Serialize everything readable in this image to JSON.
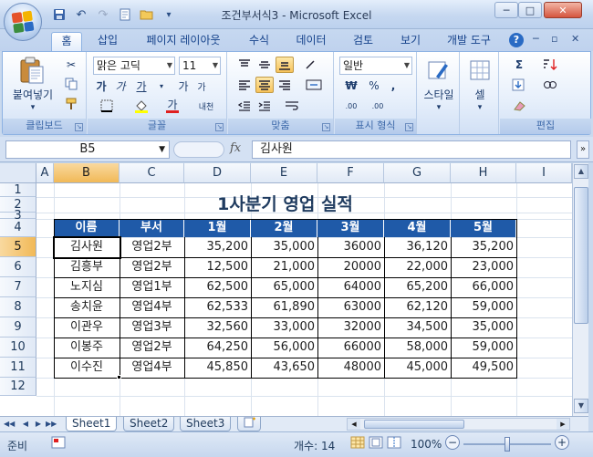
{
  "window": {
    "title": "조건부서식3 - Microsoft Excel",
    "controls": {
      "minimize": "─",
      "maximize": "□",
      "close": "✕"
    }
  },
  "quick_access": {
    "icons": [
      "save-icon",
      "undo-icon",
      "redo-icon",
      "new-icon",
      "open-icon"
    ],
    "dropdown": "▾"
  },
  "tabs": [
    {
      "label": "홈",
      "active": true
    },
    {
      "label": "삽입"
    },
    {
      "label": "페이지 레이아웃"
    },
    {
      "label": "수식"
    },
    {
      "label": "데이터"
    },
    {
      "label": "검토"
    },
    {
      "label": "보기"
    },
    {
      "label": "개발 도구"
    }
  ],
  "ribbon": {
    "clipboard": {
      "label": "클립보드",
      "paste": "붙여넣기"
    },
    "font": {
      "label": "글꼴",
      "font_name": "맑은 고딕",
      "font_size": "11",
      "bold": "가",
      "italic": "가",
      "underline": "가",
      "grow": "가",
      "shrink": "가",
      "phonetic": "내천",
      "font_color_glyph": "가"
    },
    "alignment": {
      "label": "맞춤"
    },
    "number": {
      "label": "표시 형식",
      "format": "일반",
      "currency": "₩",
      "percent": "%",
      "comma": ",",
      "inc_decimal": ".00",
      "dec_decimal": ".00"
    },
    "style": {
      "label": "스타일"
    },
    "cells": {
      "label": "셀"
    },
    "editing": {
      "label": "편집",
      "sum": "Σ"
    },
    "help": "?"
  },
  "formula_bar": {
    "name_box": "B5",
    "fx": "fx",
    "content": "김사원"
  },
  "grid": {
    "columns": [
      "A",
      "B",
      "C",
      "D",
      "E",
      "F",
      "G",
      "H",
      "I"
    ],
    "rows": [
      "1",
      "2",
      "3",
      "4",
      "5",
      "6",
      "7",
      "8",
      "9",
      "10",
      "11",
      "12"
    ],
    "selected_col": "B",
    "selected_row": "5",
    "title": "1사분기 영업 실적",
    "header": [
      "이름",
      "부서",
      "1월",
      "2월",
      "3월",
      "4월",
      "5월"
    ],
    "data": [
      [
        "김사원",
        "영업2부",
        "35,200",
        "35,000",
        "36000",
        "36,120",
        "35,200"
      ],
      [
        "김흥부",
        "영업2부",
        "12,500",
        "21,000",
        "20000",
        "22,000",
        "23,000"
      ],
      [
        "노지심",
        "영업1부",
        "62,500",
        "65,000",
        "64000",
        "65,200",
        "66,000"
      ],
      [
        "송치윤",
        "영업4부",
        "62,533",
        "61,890",
        "63000",
        "62,120",
        "59,000"
      ],
      [
        "이관우",
        "영업3부",
        "32,560",
        "33,000",
        "32000",
        "34,500",
        "35,000"
      ],
      [
        "이봉주",
        "영업2부",
        "64,250",
        "56,000",
        "66000",
        "58,000",
        "59,000"
      ],
      [
        "이수진",
        "영업4부",
        "45,850",
        "43,650",
        "48000",
        "45,000",
        "49,500"
      ]
    ]
  },
  "sheets": [
    "Sheet1",
    "Sheet2",
    "Sheet3"
  ],
  "active_sheet": "Sheet1",
  "status": {
    "mode": "준비",
    "count_label": "개수: 14",
    "zoom": "100%",
    "zoom_minus": "−",
    "zoom_plus": "+"
  },
  "colors": {
    "header_fill": "#1f5aa8",
    "selection_header": "#f1b957",
    "ribbon_text": "#15428b"
  }
}
